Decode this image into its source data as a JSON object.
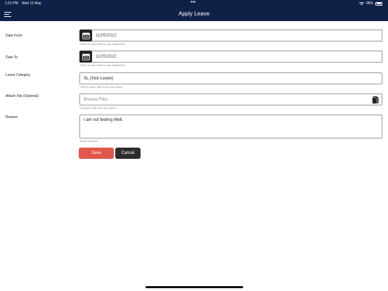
{
  "status_bar": {
    "time": "1:21 PM",
    "date": "Wed 11 May",
    "dots": "•••",
    "battery_pct": "96%"
  },
  "nav": {
    "title": "Apply Leave",
    "menu_icon": "hamburger-menu-icon"
  },
  "form": {
    "date_from": {
      "label": "Date From",
      "value": "11/05/2022",
      "hint": "*Click on input field to get datepicker",
      "icon": "calendar-icon"
    },
    "date_to": {
      "label": "Date To",
      "value": "11/05/2022",
      "hint": "*Click on input field to get datepicker",
      "icon": "calendar-icon"
    },
    "leave_category": {
      "label": "Leave Category",
      "value": "SL (Sick Leave)",
      "hint": "*Select leave type from drop-down"
    },
    "attach_file": {
      "label": "Attach File (Optional)",
      "placeholder": "Browse Files",
      "hint": "*Upload a file from you phone",
      "icon": "file-upload-icon"
    },
    "reason": {
      "label": "Reason",
      "value": "I am not feeling Well.",
      "hint": "*Enter Reason"
    }
  },
  "actions": {
    "save_label": "Save",
    "cancel_label": "Cancel"
  },
  "colors": {
    "header_bg": "#0f2147",
    "save_bg": "#e2574c",
    "cancel_bg": "#2d2d2d"
  }
}
